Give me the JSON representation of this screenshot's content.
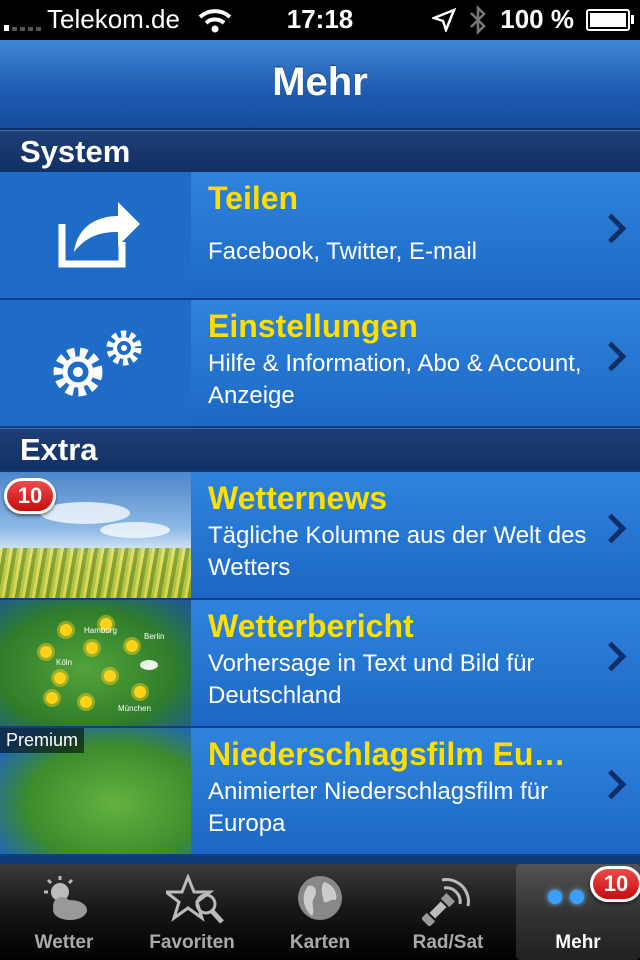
{
  "status": {
    "carrier": "Telekom.de",
    "time": "17:18",
    "battery": "100 %"
  },
  "navbar": {
    "title": "Mehr"
  },
  "sections": {
    "system": "System",
    "extra": "Extra"
  },
  "rows": [
    {
      "title": "Teilen",
      "subtitle": "Facebook, Twitter, E-mail"
    },
    {
      "title": "Einstellungen",
      "subtitle": "Hilfe & Information, Abo & Account, Anzeige"
    },
    {
      "title": "Wetternews",
      "subtitle": "Tägliche Kolumne aus der Welt des Wetters",
      "badge": "10"
    },
    {
      "title": "Wetterbericht",
      "subtitle": "Vorhersage in Text und Bild für Deutschland",
      "cities": [
        "Hamburg",
        "Berlin",
        "Köln",
        "München"
      ]
    },
    {
      "title": "Niederschlagsfilm Eu…",
      "subtitle": "Animierter Niederschlagsfilm für Europa",
      "tag": "Premium"
    }
  ],
  "tabs": [
    {
      "label": "Wetter",
      "icon": "sun-cloud-icon"
    },
    {
      "label": "Favoriten",
      "icon": "star-search-icon"
    },
    {
      "label": "Karten",
      "icon": "globe-icon"
    },
    {
      "label": "Rad/Sat",
      "icon": "satellite-icon"
    },
    {
      "label": "Mehr",
      "icon": "more-dots-icon",
      "badge": "10",
      "active": true
    }
  ],
  "colors": {
    "title_yellow": "#ffde00",
    "row_blue": "#2575d2",
    "badge_red": "#d41c1c"
  }
}
